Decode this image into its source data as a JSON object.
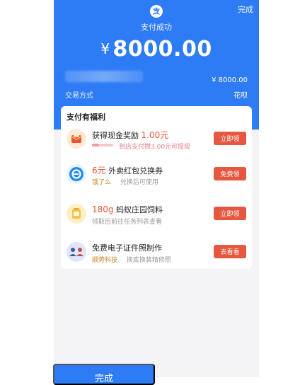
{
  "header": {
    "done_label": "完成",
    "status_text": "支付成功",
    "currency_symbol": "¥",
    "amount": "8000.00",
    "sub_amount": "¥ 8000.00",
    "pay_method_label": "交易方式",
    "pay_method_value": "花呗"
  },
  "benefits": {
    "title": "支付有福利",
    "items": [
      {
        "icon": "red-envelope-icon",
        "title": "获得现金奖励",
        "amount": "1.00元",
        "sub": "到店支付攒3.00元可提现",
        "progress": 0.33,
        "button": "立即领"
      },
      {
        "icon": "eleme-icon",
        "title_amount": "6元",
        "title": "外卖红包兑换券",
        "tag": "饿了么",
        "sub": "兑换后可使用",
        "button": "免费领"
      },
      {
        "icon": "feed-bag-icon",
        "title_amount": "180g",
        "title": "蚂蚁庄园饲料",
        "sub": "领取后前往任务列表查看",
        "button": "立即领"
      },
      {
        "icon": "id-photo-icon",
        "title": "免费电子证件照制作",
        "tag": "顺势科技",
        "sub": "换底换装精修照",
        "button": "去看看"
      }
    ]
  },
  "footer": {
    "done_button": "完成"
  },
  "colors": {
    "primary_blue": "#2d7cf6",
    "button_red": "#e6573f",
    "highlight_red": "#e8593a"
  }
}
